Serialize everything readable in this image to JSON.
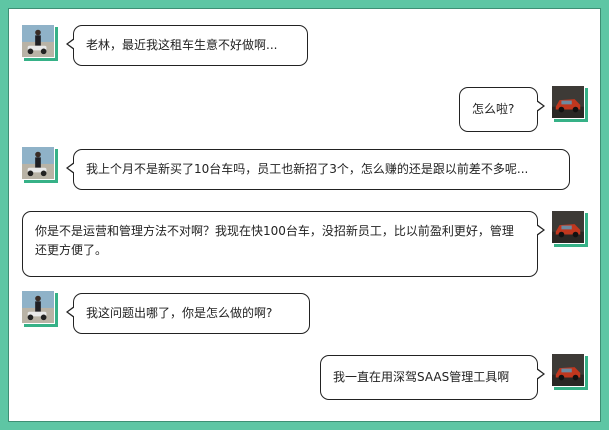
{
  "theme": {
    "frame_color": "#5ec6a4",
    "avatar_shadow": "#36b187",
    "bubble_border": "#222222"
  },
  "messages": [
    {
      "sender": "left",
      "avatar": "person-with-motorbike-avatar",
      "text": "老林，最近我这租车生意不好做啊..."
    },
    {
      "sender": "right",
      "avatar": "red-car-avatar",
      "text": "怎么啦?"
    },
    {
      "sender": "left",
      "avatar": "person-with-motorbike-avatar",
      "text": "我上个月不是新买了10台车吗，员工也新招了3个，怎么赚的还是跟以前差不多呢..."
    },
    {
      "sender": "right",
      "avatar": "red-car-avatar",
      "text": "你是不是运营和管理方法不对啊？我现在快100台车，没招新员工，比以前盈利更好，管理还更方便了。"
    },
    {
      "sender": "left",
      "avatar": "person-with-motorbike-avatar",
      "text": "我这问题出哪了，你是怎么做的啊?"
    },
    {
      "sender": "right",
      "avatar": "red-car-avatar",
      "text": "我一直在用深驾SAAS管理工具啊"
    }
  ]
}
